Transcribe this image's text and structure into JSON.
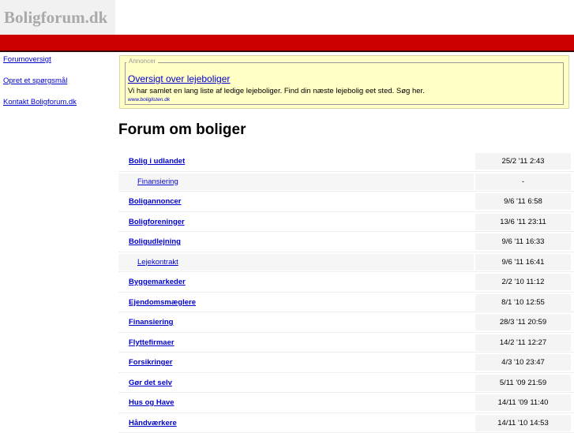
{
  "site": {
    "logo": "Boligforum.dk"
  },
  "sidebar": {
    "links": [
      "Forumoversigt",
      "Opret et spørgsmål",
      "Kontakt Boligforum.dk"
    ]
  },
  "ad": {
    "legend": "Annoncer",
    "title": "Oversigt over lejeboliger",
    "description": "Vi har samlet en lang liste af ledige lejeboliger. Find din næste lejebolig eet sted. Søg her.",
    "url": "www.boliglisten.dk"
  },
  "main": {
    "title": "Forum om boliger"
  },
  "forums": [
    {
      "name": "Bolig i udlandet",
      "date": "25/2 '11 2:43",
      "sub": false
    },
    {
      "name": "Finansiering",
      "date": "-",
      "sub": true
    },
    {
      "name": "Boligannoncer",
      "date": "9/6 '11 6:58",
      "sub": false
    },
    {
      "name": "Boligforeninger",
      "date": "13/6 '11 23:11",
      "sub": false
    },
    {
      "name": "Boligudlejning",
      "date": "9/6 '11 16:33",
      "sub": false
    },
    {
      "name": "Lejekontrakt",
      "date": "9/6 '11 16:41",
      "sub": true
    },
    {
      "name": "Byggemarkeder",
      "date": "2/2 '10 11:12",
      "sub": false
    },
    {
      "name": "Ejendomsmæglere",
      "date": "8/1 '10 12:55",
      "sub": false
    },
    {
      "name": "Finansiering",
      "date": "28/3 '11 20:59",
      "sub": false
    },
    {
      "name": "Flyttefirmaer",
      "date": "14/2 '11 12:27",
      "sub": false
    },
    {
      "name": "Forsikringer",
      "date": "4/3 '10 23:47",
      "sub": false
    },
    {
      "name": "Gør det selv",
      "date": "5/11 '09 21:59",
      "sub": false
    },
    {
      "name": "Hus og Have",
      "date": "14/11 '09 11:40",
      "sub": false
    },
    {
      "name": "Håndværkere",
      "date": "14/11 '10 14:53",
      "sub": false
    }
  ]
}
